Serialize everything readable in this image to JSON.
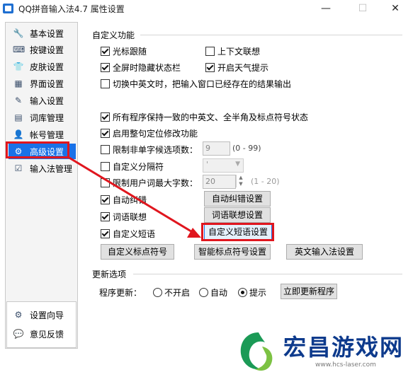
{
  "window": {
    "title": "QQ拼音输入法4.7 属性设置",
    "minimize": "—",
    "maximize": "☐",
    "close": "✕"
  },
  "sidebar": {
    "items": [
      {
        "label": "基本设置",
        "icon": "wrench-icon",
        "glyph": "🔧"
      },
      {
        "label": "按键设置",
        "icon": "keyboard-icon",
        "glyph": "⌨"
      },
      {
        "label": "皮肤设置",
        "icon": "shirt-icon",
        "glyph": "👕"
      },
      {
        "label": "界面设置",
        "icon": "layout-icon",
        "glyph": "▦"
      },
      {
        "label": "输入设置",
        "icon": "input-icon",
        "glyph": "✎"
      },
      {
        "label": "词库管理",
        "icon": "dictionary-icon",
        "glyph": "▤"
      },
      {
        "label": "帐号管理",
        "icon": "account-icon",
        "glyph": "👤"
      },
      {
        "label": "高级设置",
        "icon": "advanced-icon",
        "glyph": "⚙",
        "active": true
      },
      {
        "label": "输入法管理",
        "icon": "manage-icon",
        "glyph": "☑"
      }
    ],
    "bottom": [
      {
        "label": "设置向导",
        "icon": "wizard-icon",
        "glyph": "⚙"
      },
      {
        "label": "意见反馈",
        "icon": "feedback-icon",
        "glyph": "💬"
      }
    ]
  },
  "custom": {
    "title": "自定义功能",
    "cursor_follow": "光标跟随",
    "context_assoc": "上下文联想",
    "hide_status_fullscreen": "全屏时隐藏状态栏",
    "weather_tips": "开启天气提示",
    "switch_cn_en": "切换中英文时，把输入窗口已经存在的结果输出",
    "consistent_state": "所有程序保持一致的中英文、全半角及标点符号状态",
    "sentence_correction": "启用整句定位修改功能",
    "limit_candidates": "限制非单字候选项数：",
    "limit_candidates_value": "9",
    "limit_candidates_range": "(0 - 99)",
    "custom_separator": "自定义分隔符",
    "separator_value": "'",
    "limit_user_words": "限制用户词最大字数：",
    "limit_user_words_value": "20",
    "limit_user_words_range": "(1 - 20)",
    "auto_correct": "自动纠错",
    "auto_correct_btn": "自动纠错设置",
    "word_assoc": "词语联想",
    "word_assoc_btn": "词语联想设置",
    "custom_phrase": "自定义短语",
    "custom_phrase_btn": "自定义短语设置",
    "custom_punct_btn": "自定义标点符号",
    "smart_punct_btn": "智能标点符号设置",
    "english_input_btn": "英文输入法设置"
  },
  "update": {
    "title": "更新选项",
    "label": "程序更新：",
    "opt_off": "不开启",
    "opt_auto": "自动",
    "opt_notify": "提示",
    "update_now_btn": "立即更新程序"
  },
  "watermark": {
    "title": "宏昌游戏网",
    "url": "www.hcs-laser.com"
  },
  "colors": {
    "accent": "#1a72e8",
    "highlight": "#e0161e"
  }
}
